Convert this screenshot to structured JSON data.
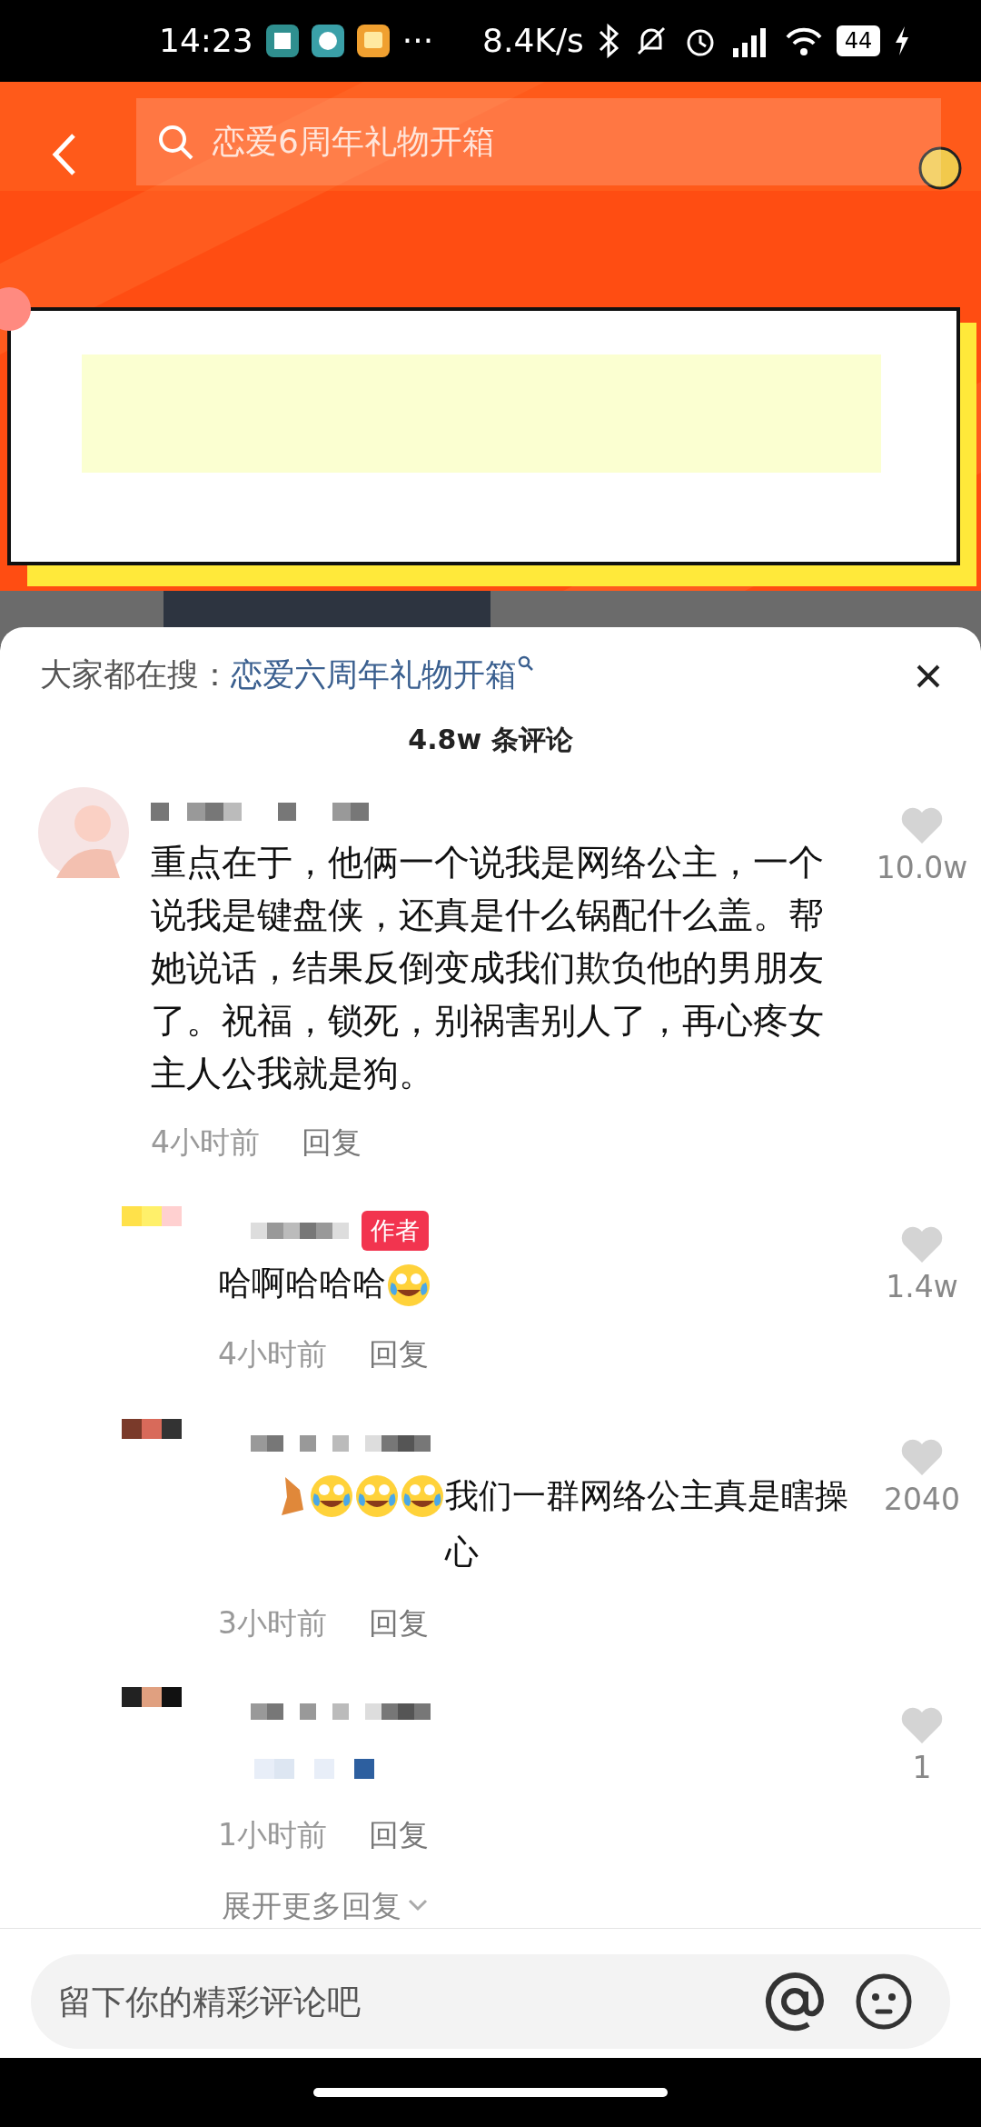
{
  "status_bar": {
    "time": "14:23",
    "more": "···",
    "network_speed": "8.4K/s",
    "battery": "44",
    "charging": true
  },
  "video": {
    "kind": "picture",
    "search": {
      "value": "恋爱6周年礼物开箱"
    }
  },
  "hot_search": {
    "label": "大家都在搜：",
    "query": "恋爱六周年礼物开箱"
  },
  "comment_count": "4.8w 条评论",
  "comments": [
    {
      "content": [
        {
          "kind": "text",
          "text": "重点在于，他俩一个说我是网络公主，一个说我是键盘侠，还真是什么锅配什么盖。帮她说话，结果反倒变成我们欺负他的男朋友了。祝福，锁死，别祸害别人了，再心疼女主人公我就是狗。"
        }
      ],
      "time": "4小时前",
      "reply": "回复",
      "likes": "10.0w",
      "liked": false,
      "replies": [
        {
          "author_badge": "作者",
          "content": [
            {
              "kind": "text",
              "text": "哈啊哈哈哈"
            },
            {
              "kind": "emoji"
            }
          ],
          "time": "4小时前",
          "reply": "回复",
          "likes": "1.4w",
          "liked": false
        },
        {
          "content": [
            {
              "kind": "sticker"
            },
            {
              "kind": "emoji"
            },
            {
              "kind": "emoji"
            },
            {
              "kind": "emoji"
            },
            {
              "kind": "text",
              "text": "我们一群网络公主真是瞎操心"
            }
          ],
          "time": "3小时前",
          "reply": "回复",
          "likes": "2040",
          "liked": false
        },
        {
          "content": [
            {
              "kind": "hidden"
            }
          ],
          "time": "1小时前",
          "reply": "回复",
          "likes": "1",
          "liked": false
        }
      ],
      "show_more": "展开更多回复"
    }
  ],
  "input": {
    "placeholder": "留下你的精彩评论吧"
  }
}
